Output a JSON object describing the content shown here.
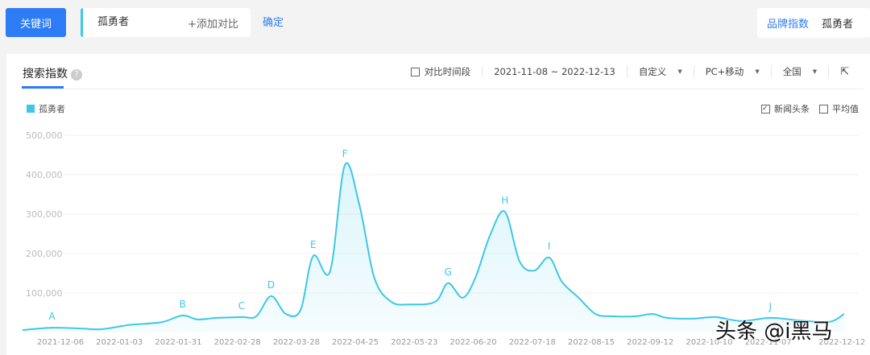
{
  "topbar": {
    "keyword_button": "关键词",
    "keyword_value": "孤勇者",
    "add_compare": "+添加对比",
    "confirm": "确定",
    "brand_index": "品牌指数",
    "brand_keyword": "孤勇者"
  },
  "panel": {
    "tab": "搜索指数",
    "help": "?",
    "compare_period": "对比时间段",
    "date_range": "2021-11-08 ~ 2022-12-13",
    "custom": "自定义",
    "device": "PC+移动",
    "region": "全国",
    "legend": "孤勇者",
    "news": "新闻头条",
    "average": "平均值"
  },
  "watermark": "头条 @i黑马",
  "colors": {
    "accent": "#2d7cf6",
    "series": "#3cc8e6"
  },
  "chart_data": {
    "type": "area",
    "yticks": [
      "100,000",
      "200,000",
      "300,000",
      "400,000",
      "500,000"
    ],
    "ylim": [
      0,
      500000
    ],
    "xticks": [
      "2021-12-06",
      "2022-01-03",
      "2022-01-31",
      "2022-02-28",
      "2022-03-28",
      "2022-04-25",
      "2022-05-23",
      "2022-06-20",
      "2022-07-18",
      "2022-08-15",
      "2022-09-12",
      "2022-10-10",
      "2022-11-07",
      "2022-12-12"
    ],
    "series": [
      {
        "name": "孤勇者",
        "points": [
          [
            "2021-11-18",
            6000
          ],
          [
            "2021-12-02",
            12000
          ],
          [
            "2021-12-16",
            10000
          ],
          [
            "2021-12-25",
            8000
          ],
          [
            "2022-01-04",
            16000
          ],
          [
            "2022-01-09",
            20000
          ],
          [
            "2022-01-23",
            26000
          ],
          [
            "2022-02-02",
            43000
          ],
          [
            "2022-02-09",
            33000
          ],
          [
            "2022-02-18",
            37000
          ],
          [
            "2022-03-02",
            39000
          ],
          [
            "2022-03-09",
            41000
          ],
          [
            "2022-03-16",
            92000
          ],
          [
            "2022-03-23",
            47000
          ],
          [
            "2022-03-30",
            57000
          ],
          [
            "2022-04-05",
            194000
          ],
          [
            "2022-04-13",
            155000
          ],
          [
            "2022-04-20",
            424000
          ],
          [
            "2022-04-27",
            322000
          ],
          [
            "2022-05-04",
            139000
          ],
          [
            "2022-05-12",
            78000
          ],
          [
            "2022-05-21",
            71000
          ],
          [
            "2022-06-02",
            78000
          ],
          [
            "2022-06-08",
            125000
          ],
          [
            "2022-06-15",
            88000
          ],
          [
            "2022-06-21",
            139000
          ],
          [
            "2022-06-28",
            247000
          ],
          [
            "2022-07-05",
            306000
          ],
          [
            "2022-07-12",
            180000
          ],
          [
            "2022-07-19",
            157000
          ],
          [
            "2022-07-26",
            190000
          ],
          [
            "2022-08-01",
            129000
          ],
          [
            "2022-08-09",
            88000
          ],
          [
            "2022-08-17",
            47000
          ],
          [
            "2022-08-25",
            41000
          ],
          [
            "2022-09-05",
            41000
          ],
          [
            "2022-09-13",
            47000
          ],
          [
            "2022-09-20",
            37000
          ],
          [
            "2022-10-02",
            35000
          ],
          [
            "2022-10-13",
            39000
          ],
          [
            "2022-10-25",
            29000
          ],
          [
            "2022-11-08",
            37000
          ],
          [
            "2022-11-21",
            31000
          ],
          [
            "2022-12-06",
            27000
          ],
          [
            "2022-12-13",
            47000
          ]
        ]
      }
    ],
    "annotations": [
      {
        "label": "A",
        "date": "2021-12-02"
      },
      {
        "label": "B",
        "date": "2022-02-02"
      },
      {
        "label": "C",
        "date": "2022-03-02"
      },
      {
        "label": "D",
        "date": "2022-03-16"
      },
      {
        "label": "E",
        "date": "2022-04-05"
      },
      {
        "label": "F",
        "date": "2022-04-20"
      },
      {
        "label": "G",
        "date": "2022-06-08"
      },
      {
        "label": "H",
        "date": "2022-07-05"
      },
      {
        "label": "I",
        "date": "2022-07-26"
      },
      {
        "label": "J",
        "date": "2022-11-08"
      }
    ],
    "grid": true
  }
}
